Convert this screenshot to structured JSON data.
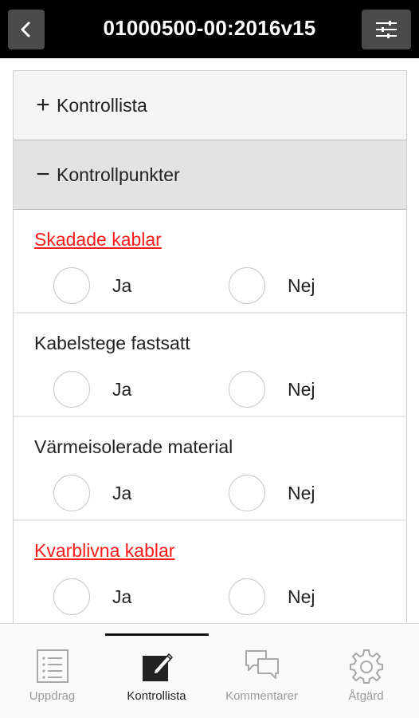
{
  "header": {
    "title": "01000500-00:2016v15",
    "back_icon": "chevron-left-icon",
    "settings_icon": "sliders-icon"
  },
  "accordion": [
    {
      "sign": "+",
      "label": "Kontrollista",
      "expanded": false
    },
    {
      "sign": "−",
      "label": "Kontrollpunkter",
      "expanded": true
    }
  ],
  "checkpoints": [
    {
      "label": "Skadade kablar",
      "highlight": true,
      "yes": "Ja",
      "no": "Nej"
    },
    {
      "label": "Kabelstege fastsatt",
      "highlight": false,
      "yes": "Ja",
      "no": "Nej"
    },
    {
      "label": "Värmeisolerade material",
      "highlight": false,
      "yes": "Ja",
      "no": "Nej"
    },
    {
      "label": "Kvarblivna kablar",
      "highlight": true,
      "yes": "Ja",
      "no": "Nej"
    }
  ],
  "colors": {
    "highlight": "#ff1a1a",
    "topbar": "#000000",
    "button": "#4a4a4a"
  },
  "bottom_nav": [
    {
      "label": "Uppdrag",
      "icon": "list-icon",
      "active": false
    },
    {
      "label": "Kontrollista",
      "icon": "edit-icon",
      "active": true
    },
    {
      "label": "Kommentarer",
      "icon": "comments-icon",
      "active": false
    },
    {
      "label": "Åtgärd",
      "icon": "gear-icon",
      "active": false
    }
  ]
}
